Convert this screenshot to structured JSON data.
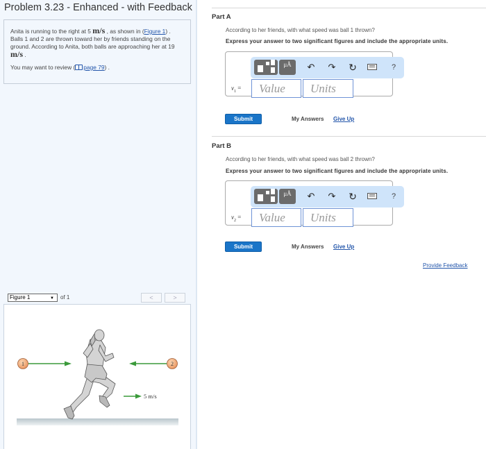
{
  "problem": {
    "title": "Problem 3.23 - Enhanced - with Feedback",
    "text_1": "Anita is running to the right at 5 ",
    "unit_1": "m/s",
    "text_2": " , as shown in ",
    "figure_link": "Figure 1",
    "text_3": " . Balls 1 and 2 are thrown toward her by friends standing on the ground. According to Anita, both balls are approaching her at 19 ",
    "unit_2": "m/s",
    "text_4": " .",
    "review_prefix": "You may want to review (",
    "review_link": "page 79",
    "review_suffix": ") ."
  },
  "figure": {
    "selected": "Figure 1",
    "of_label": "of 1",
    "prev": "<",
    "next": ">",
    "ball_1_label": "1",
    "ball_2_label": "2",
    "speed_label": "5 m/s",
    "colors": {
      "arrow": "#3a9a3a",
      "ball": "#f0a870"
    }
  },
  "parts": [
    {
      "title": "Part A",
      "question": "According to her friends, with what speed was ball 1 thrown?",
      "instruction": "Express your answer to two significant figures and include the appropriate units.",
      "variable": "v",
      "subscript": "1",
      "equals": " =",
      "value_placeholder": "Value",
      "units_placeholder": "Units",
      "submit": "Submit",
      "my_answers": "My Answers",
      "give_up": "Give Up"
    },
    {
      "title": "Part B",
      "question": "According to her friends, with what speed was ball 2 thrown?",
      "instruction": "Express your answer to two significant figures and include the appropriate units.",
      "variable": "v",
      "subscript": "2",
      "equals": " =",
      "value_placeholder": "Value",
      "units_placeholder": "Units",
      "submit": "Submit",
      "my_answers": "My Answers",
      "give_up": "Give Up"
    }
  ],
  "toolbar": {
    "mu_label": "μÅ",
    "undo": "↶",
    "redo": "↷",
    "reset": "↻",
    "help": "?"
  },
  "feedback_link": "Provide Feedback",
  "colors": {
    "accent": "#1a75c8",
    "link": "#2255aa",
    "panel_bg": "#f2f7fd",
    "toolbar_bg": "#cfe4fa"
  }
}
